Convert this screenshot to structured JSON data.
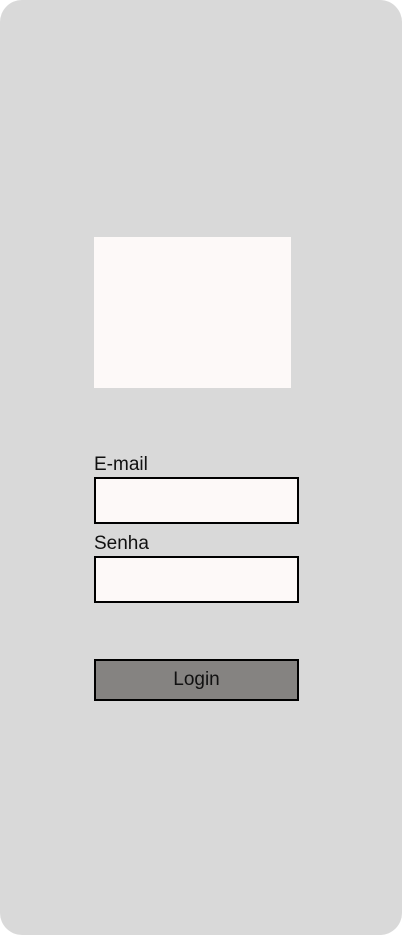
{
  "login_form": {
    "email_label": "E-mail",
    "email_value": "",
    "password_label": "Senha",
    "password_value": "",
    "login_button_label": "Login"
  },
  "colors": {
    "screen_background": "#d9d9d9",
    "input_background": "#fdf9f8",
    "button_background": "#858381",
    "border": "#000000",
    "text": "#111111"
  }
}
